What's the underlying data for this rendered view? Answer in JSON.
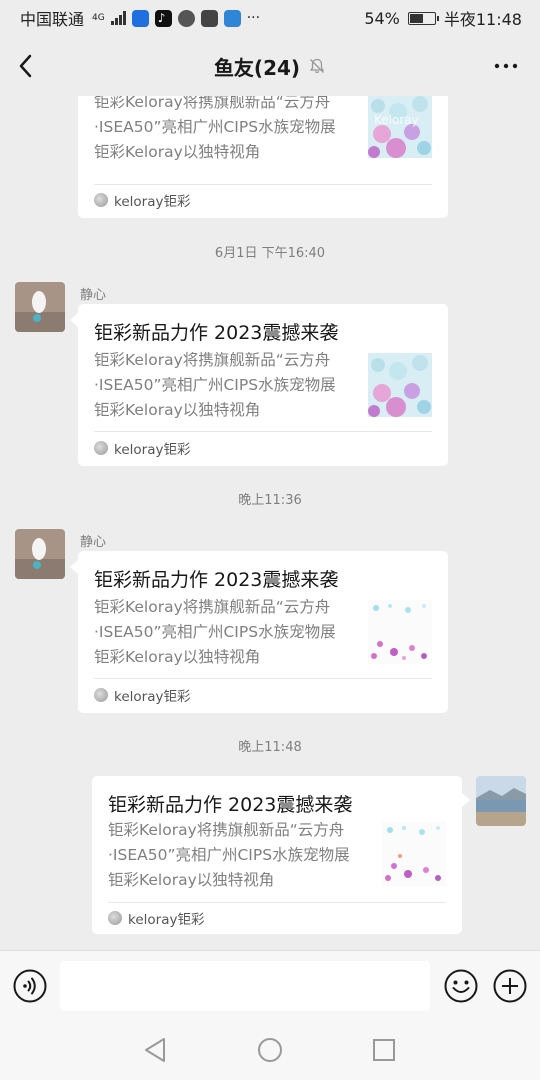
{
  "status_bar": {
    "carrier": "中国联通",
    "network": "4G",
    "battery": "54%",
    "time": "半夜11:48",
    "more": "···"
  },
  "header": {
    "title": "鱼友(24)",
    "icons": [
      "back-icon",
      "mute-bell-icon",
      "more-icon"
    ]
  },
  "messages": [
    {
      "kind": "partial-card",
      "desc": [
        "钜彩Keloray将携旗舰新品“云方舟",
        "·ISEA50”亮相广州CIPS水族宠物展",
        "钜彩Keloray以独特视角"
      ],
      "source": "keloray钜彩"
    },
    {
      "timestamp": "6月1日 下午16:40",
      "sender": "静心",
      "title": "钜彩新品力作 2023震撼来袭",
      "desc": [
        "钜彩Keloray将携旗舰新品“云方舟",
        "·ISEA50”亮相广州CIPS水族宠物展",
        "钜彩Keloray以独特视角"
      ],
      "source": "keloray钜彩"
    },
    {
      "timestamp": "晚上11:36",
      "sender": "静心",
      "title": "钜彩新品力作 2023震撼来袭",
      "desc": [
        "钜彩Keloray将携旗舰新品“云方舟",
        "·ISEA50”亮相广州CIPS水族宠物展",
        "钜彩Keloray以独特视角"
      ],
      "source": "keloray钜彩"
    },
    {
      "timestamp": "晚上11:48",
      "sender": "",
      "title": "钜彩新品力作 2023震撼来袭",
      "desc": [
        "钜彩Keloray将携旗舰新品“云方舟",
        "·ISEA50”亮相广州CIPS水族宠物展",
        "钜彩Keloray以独特视角"
      ],
      "source": "keloray钜彩"
    }
  ],
  "input": {
    "placeholder": "",
    "value": ""
  },
  "colors": {
    "background": "#ededed",
    "card": "#ffffff",
    "muted_text": "#7f7f7f"
  }
}
